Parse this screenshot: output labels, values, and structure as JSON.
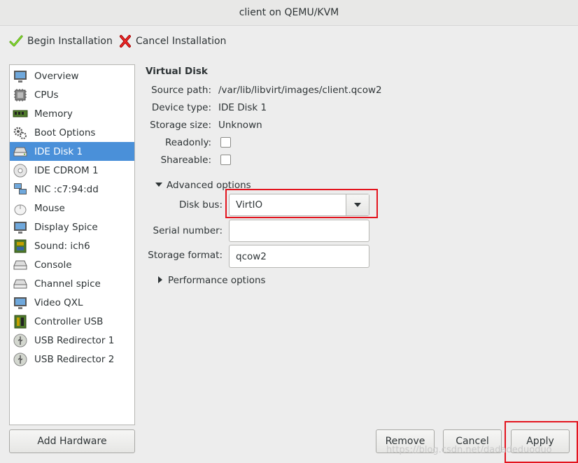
{
  "window": {
    "title": "client on QEMU/KVM"
  },
  "toolbar": {
    "begin_label": "Begin Installation",
    "cancel_label": "Cancel Installation"
  },
  "sidebar": {
    "items": [
      {
        "label": "Overview",
        "icon": "monitor-icon"
      },
      {
        "label": "CPUs",
        "icon": "cpu-icon"
      },
      {
        "label": "Memory",
        "icon": "memory-icon"
      },
      {
        "label": "Boot Options",
        "icon": "gears-icon"
      },
      {
        "label": "IDE Disk 1",
        "icon": "harddisk-icon"
      },
      {
        "label": "IDE CDROM 1",
        "icon": "cdrom-icon"
      },
      {
        "label": "NIC :c7:94:dd",
        "icon": "network-icon"
      },
      {
        "label": "Mouse",
        "icon": "mouse-icon"
      },
      {
        "label": "Display Spice",
        "icon": "display-icon"
      },
      {
        "label": "Sound: ich6",
        "icon": "sound-icon"
      },
      {
        "label": "Console",
        "icon": "console-icon"
      },
      {
        "label": "Channel spice",
        "icon": "channel-icon"
      },
      {
        "label": "Video QXL",
        "icon": "video-icon"
      },
      {
        "label": "Controller USB",
        "icon": "controller-icon"
      },
      {
        "label": "USB Redirector 1",
        "icon": "usb-icon"
      },
      {
        "label": "USB Redirector 2",
        "icon": "usb-icon"
      }
    ],
    "selected_index": 4,
    "add_hardware_label": "Add Hardware"
  },
  "details": {
    "section_title": "Virtual Disk",
    "source_path_label": "Source path:",
    "source_path_value": "/var/lib/libvirt/images/client.qcow2",
    "device_type_label": "Device type:",
    "device_type_value": "IDE Disk 1",
    "storage_size_label": "Storage size:",
    "storage_size_value": "Unknown",
    "readonly_label": "Readonly:",
    "shareable_label": "Shareable:",
    "advanced_label": "Advanced options",
    "disk_bus_label": "Disk bus:",
    "disk_bus_value": "VirtIO",
    "serial_label": "Serial number:",
    "serial_value": "",
    "storage_format_label": "Storage format:",
    "storage_format_value": "qcow2",
    "performance_label": "Performance options"
  },
  "footer": {
    "remove_label": "Remove",
    "cancel_label": "Cancel",
    "apply_label": "Apply",
    "watermark": "https://blog.csdn.net/dadadeduoduo"
  },
  "colors": {
    "selection": "#4a90d9",
    "highlight": "#e3141e"
  }
}
